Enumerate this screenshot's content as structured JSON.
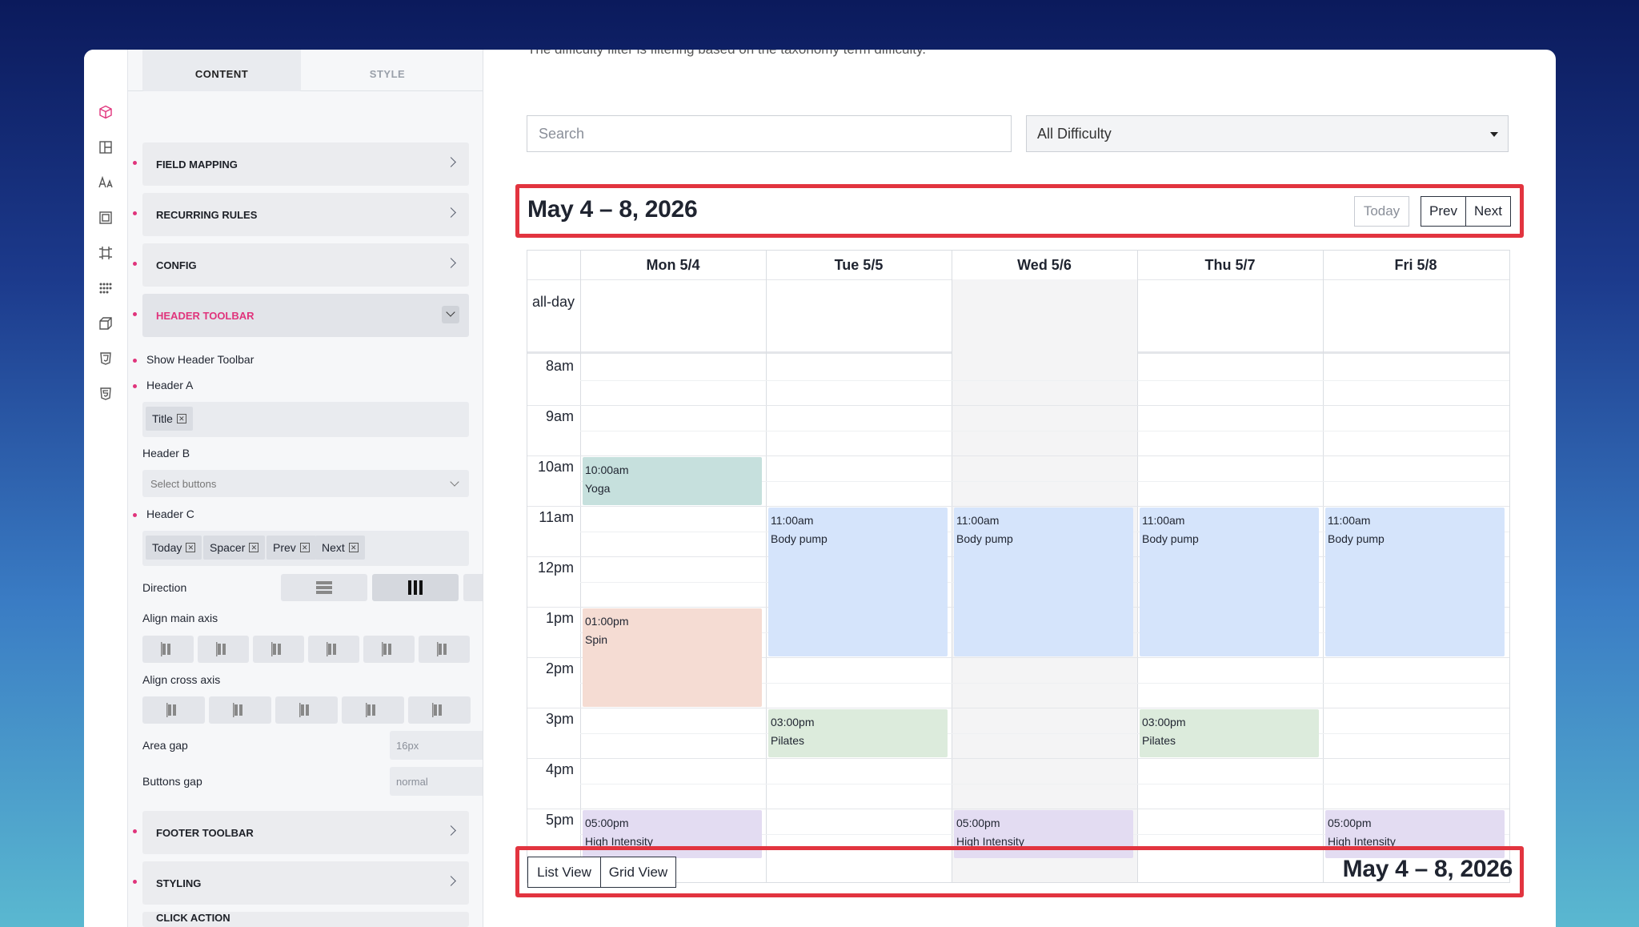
{
  "panel": {
    "tabs": [
      "CONTENT",
      "STYLE"
    ],
    "accordions": {
      "field_mapping": "FIELD MAPPING",
      "recurring_rules": "RECURRING RULES",
      "config": "CONFIG",
      "header_toolbar": "HEADER TOOLBAR",
      "footer_toolbar": "FOOTER TOOLBAR",
      "styling": "STYLING",
      "click_action": "CLICK ACTION"
    },
    "show_header_toolbar": "Show Header Toolbar",
    "header_a": "Header A",
    "header_a_tags": [
      "Title"
    ],
    "header_b": "Header B",
    "header_b_placeholder": "Select buttons",
    "header_c": "Header C",
    "header_c_tags": [
      "Today",
      "Spacer",
      "Prev",
      "Next"
    ],
    "direction": "Direction",
    "align_main": "Align main axis",
    "align_cross": "Align cross axis",
    "area_gap": "Area gap",
    "area_gap_value": "16px",
    "buttons_gap": "Buttons gap",
    "buttons_gap_value": "normal"
  },
  "main": {
    "description": "The difficulty filter is filtering based on the taxonomy term difficulty.",
    "search_placeholder": "Search",
    "difficulty_selected": "All Difficulty",
    "title": "May 4 – 8, 2026",
    "buttons": {
      "today": "Today",
      "prev": "Prev",
      "next": "Next"
    },
    "footer_buttons": {
      "list": "List View",
      "grid": "Grid View"
    },
    "footer_title": "May 4 – 8, 2026",
    "all_day": "all-day",
    "days": [
      "Mon 5/4",
      "Tue 5/5",
      "Wed 5/6",
      "Thu 5/7",
      "Fri 5/8"
    ],
    "hours": [
      "8am",
      "9am",
      "10am",
      "11am",
      "12pm",
      "1pm",
      "2pm",
      "3pm",
      "4pm",
      "5pm"
    ],
    "events": [
      {
        "day": 0,
        "start": 10,
        "end": 11,
        "time": "10:00am",
        "title": "Yoga",
        "color": "#c6e0dd"
      },
      {
        "day": 0,
        "start": 13,
        "end": 15,
        "time": "01:00pm",
        "title": "Spin",
        "color": "#f5dcd3"
      },
      {
        "day": 0,
        "start": 17,
        "end": 18,
        "time": "05:00pm",
        "title": "High Intensity",
        "color": "#e3dcf2"
      },
      {
        "day": 1,
        "start": 11,
        "end": 14,
        "time": "11:00am",
        "title": "Body pump",
        "color": "#d5e4fb"
      },
      {
        "day": 1,
        "start": 15,
        "end": 16,
        "time": "03:00pm",
        "title": "Pilates",
        "color": "#dcebdc"
      },
      {
        "day": 2,
        "start": 11,
        "end": 14,
        "time": "11:00am",
        "title": "Body pump",
        "color": "#d5e4fb"
      },
      {
        "day": 2,
        "start": 17,
        "end": 18,
        "time": "05:00pm",
        "title": "High Intensity",
        "color": "#e3dcf2"
      },
      {
        "day": 3,
        "start": 11,
        "end": 14,
        "time": "11:00am",
        "title": "Body pump",
        "color": "#d5e4fb"
      },
      {
        "day": 3,
        "start": 15,
        "end": 16,
        "time": "03:00pm",
        "title": "Pilates",
        "color": "#dcebdc"
      },
      {
        "day": 4,
        "start": 11,
        "end": 14,
        "time": "11:00am",
        "title": "Body pump",
        "color": "#d5e4fb"
      },
      {
        "day": 4,
        "start": 17,
        "end": 18,
        "time": "05:00pm",
        "title": "High Intensity",
        "color": "#e3dcf2"
      }
    ],
    "today_index": 2
  },
  "colors": {
    "accent": "#e0347c",
    "highlight": "#e2343f"
  },
  "icons": [
    "cube-icon",
    "layout-icon",
    "typography-icon",
    "frame-icon",
    "crop-icon",
    "grid-dots-icon",
    "box3d-icon",
    "css3-icon",
    "html5-icon"
  ]
}
